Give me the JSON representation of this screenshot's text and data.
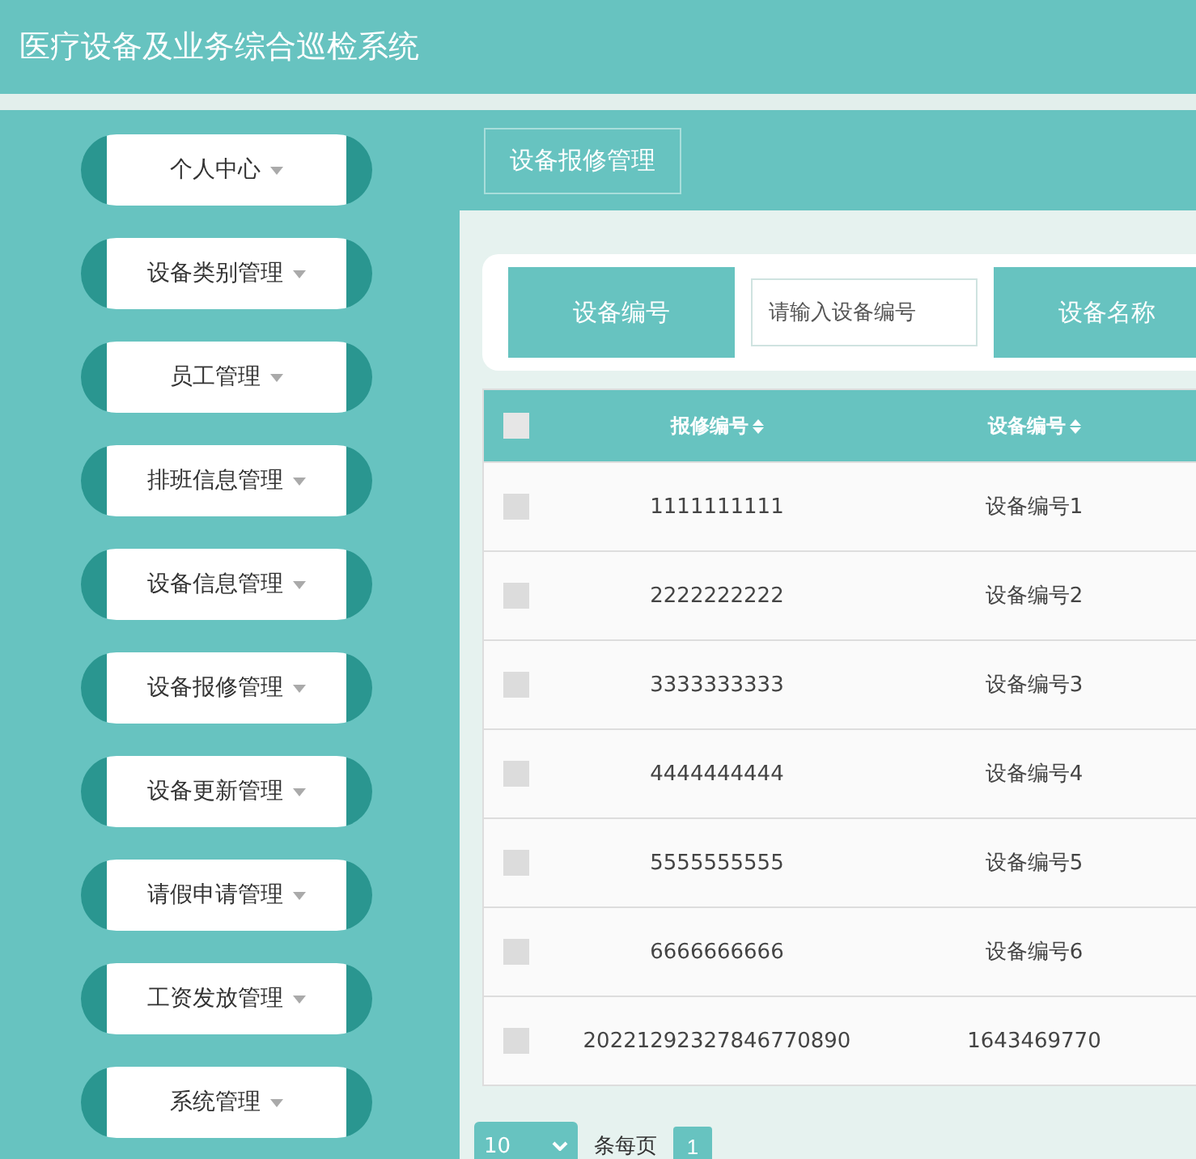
{
  "header": {
    "title": "医疗设备及业务综合巡检系统"
  },
  "sidebar": {
    "items": [
      {
        "label": "个人中心",
        "expanded": false
      },
      {
        "label": "设备类别管理",
        "expanded": false
      },
      {
        "label": "员工管理",
        "expanded": false
      },
      {
        "label": "排班信息管理",
        "expanded": false
      },
      {
        "label": "设备信息管理",
        "expanded": false
      },
      {
        "label": "设备报修管理",
        "expanded": false
      },
      {
        "label": "设备更新管理",
        "expanded": false
      },
      {
        "label": "请假申请管理",
        "expanded": false
      },
      {
        "label": "工资发放管理",
        "expanded": false
      },
      {
        "label": "系统管理",
        "expanded": false
      }
    ]
  },
  "breadcrumb": "设备报修管理",
  "search": {
    "fields": [
      {
        "label": "设备编号",
        "placeholder": "请输入设备编号"
      }
    ],
    "next_label": "设备名称"
  },
  "table": {
    "select_all": {
      "checked": false
    },
    "columns": [
      "报修编号",
      "设备编号"
    ],
    "rows": [
      {
        "checked": false,
        "cells": [
          "1111111111",
          "设备编号1"
        ]
      },
      {
        "checked": false,
        "cells": [
          "2222222222",
          "设备编号2"
        ]
      },
      {
        "checked": false,
        "cells": [
          "3333333333",
          "设备编号3"
        ]
      },
      {
        "checked": false,
        "cells": [
          "4444444444",
          "设备编号4"
        ]
      },
      {
        "checked": false,
        "cells": [
          "5555555555",
          "设备编号5"
        ]
      },
      {
        "checked": false,
        "cells": [
          "6666666666",
          "设备编号6"
        ]
      },
      {
        "checked": false,
        "cells": [
          "20221292327846770890",
          "1643469770"
        ]
      }
    ]
  },
  "pagination": {
    "page_size": "10",
    "page_size_label": "条每页",
    "pages": [
      {
        "label": "1",
        "selected": true
      }
    ]
  }
}
